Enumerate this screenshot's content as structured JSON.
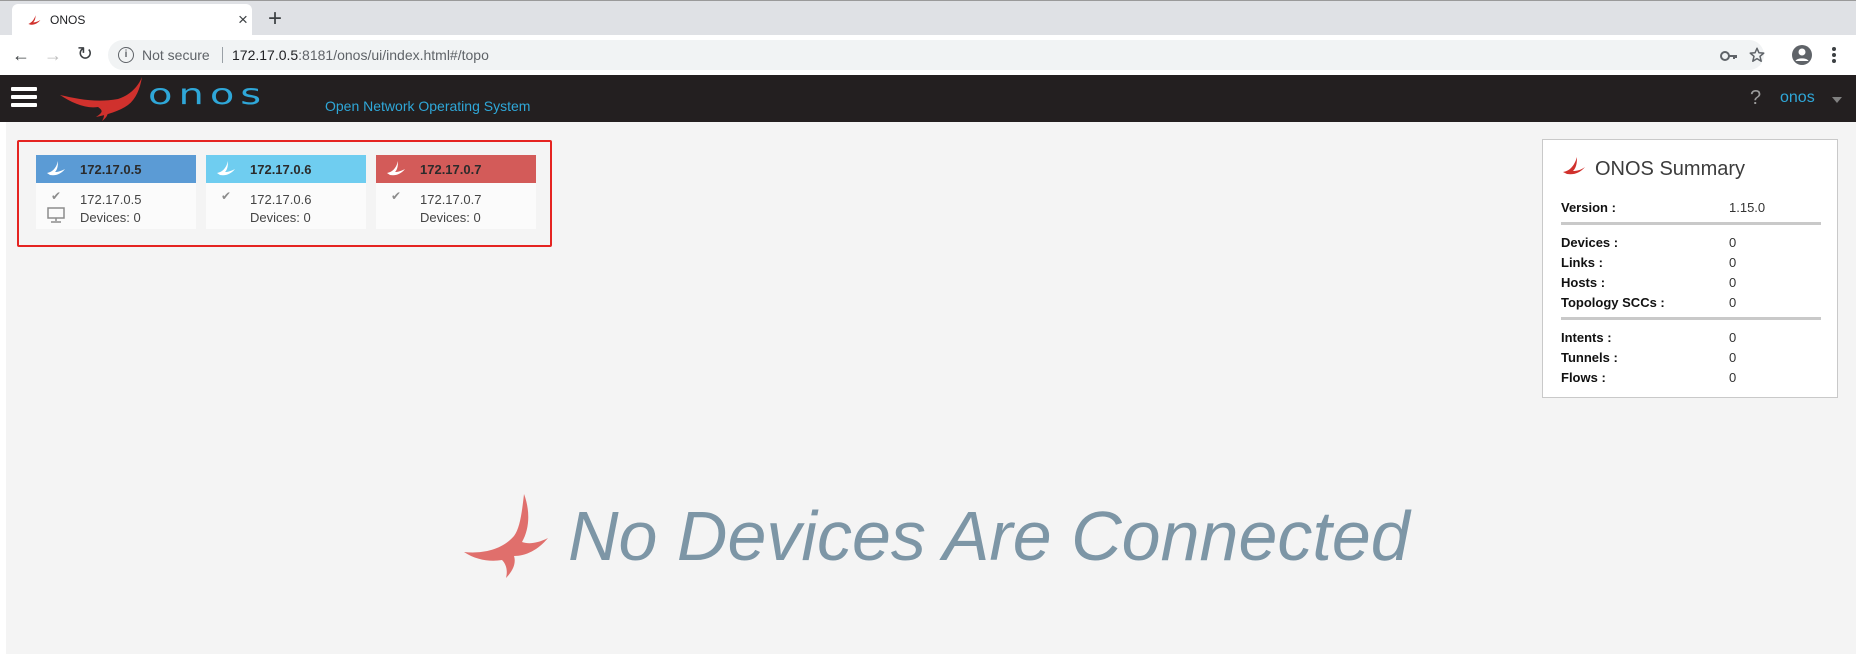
{
  "browser": {
    "tab": {
      "title": "ONOS",
      "close_glyph": "×",
      "favicon": "onos-bird-icon"
    },
    "new_tab_glyph": "+",
    "nav": {
      "back_glyph": "←",
      "forward_glyph": "→",
      "reload_glyph": "↻"
    },
    "omnibox": {
      "security_label": "Not secure",
      "url_host": "172.17.0.5",
      "url_rest": ":8181/onos/ui/index.html#/topo"
    },
    "icons": {
      "info": "info-icon",
      "key": "key-icon",
      "star": "star-icon",
      "profile": "account-icon",
      "menu": "more-vert-icon"
    }
  },
  "masthead": {
    "brand": "onos",
    "tagline": "Open Network Operating System",
    "help_glyph": "?",
    "user": "onos",
    "background": "#231f20",
    "brand_color": "#2fa7d8"
  },
  "cluster": {
    "instances": [
      {
        "title": "172.17.0.5",
        "ip": "172.17.0.5",
        "devices": "Devices: 0",
        "header_color": "#5b9bd5",
        "check": "✔",
        "is_self": true
      },
      {
        "title": "172.17.0.6",
        "ip": "172.17.0.6",
        "devices": "Devices: 0",
        "header_color": "#6fcdf0",
        "check": "✔",
        "is_self": false
      },
      {
        "title": "172.17.0.7",
        "ip": "172.17.0.7",
        "devices": "Devices: 0",
        "header_color": "#d35b59",
        "check": "✔",
        "is_self": false
      }
    ],
    "frame_color": "#e52421"
  },
  "summary": {
    "title": "ONOS Summary",
    "version": {
      "label": "Version :",
      "value": "1.15.0"
    },
    "topology": [
      {
        "label": "Devices :",
        "value": "0"
      },
      {
        "label": "Links :",
        "value": "0"
      },
      {
        "label": "Hosts :",
        "value": "0"
      },
      {
        "label": "Topology SCCs :",
        "value": "0"
      }
    ],
    "flows": [
      {
        "label": "Intents :",
        "value": "0"
      },
      {
        "label": "Tunnels :",
        "value": "0"
      },
      {
        "label": "Flows :",
        "value": "0"
      }
    ]
  },
  "empty_state": {
    "message": "No Devices Are Connected",
    "color": "#7d96a6"
  }
}
